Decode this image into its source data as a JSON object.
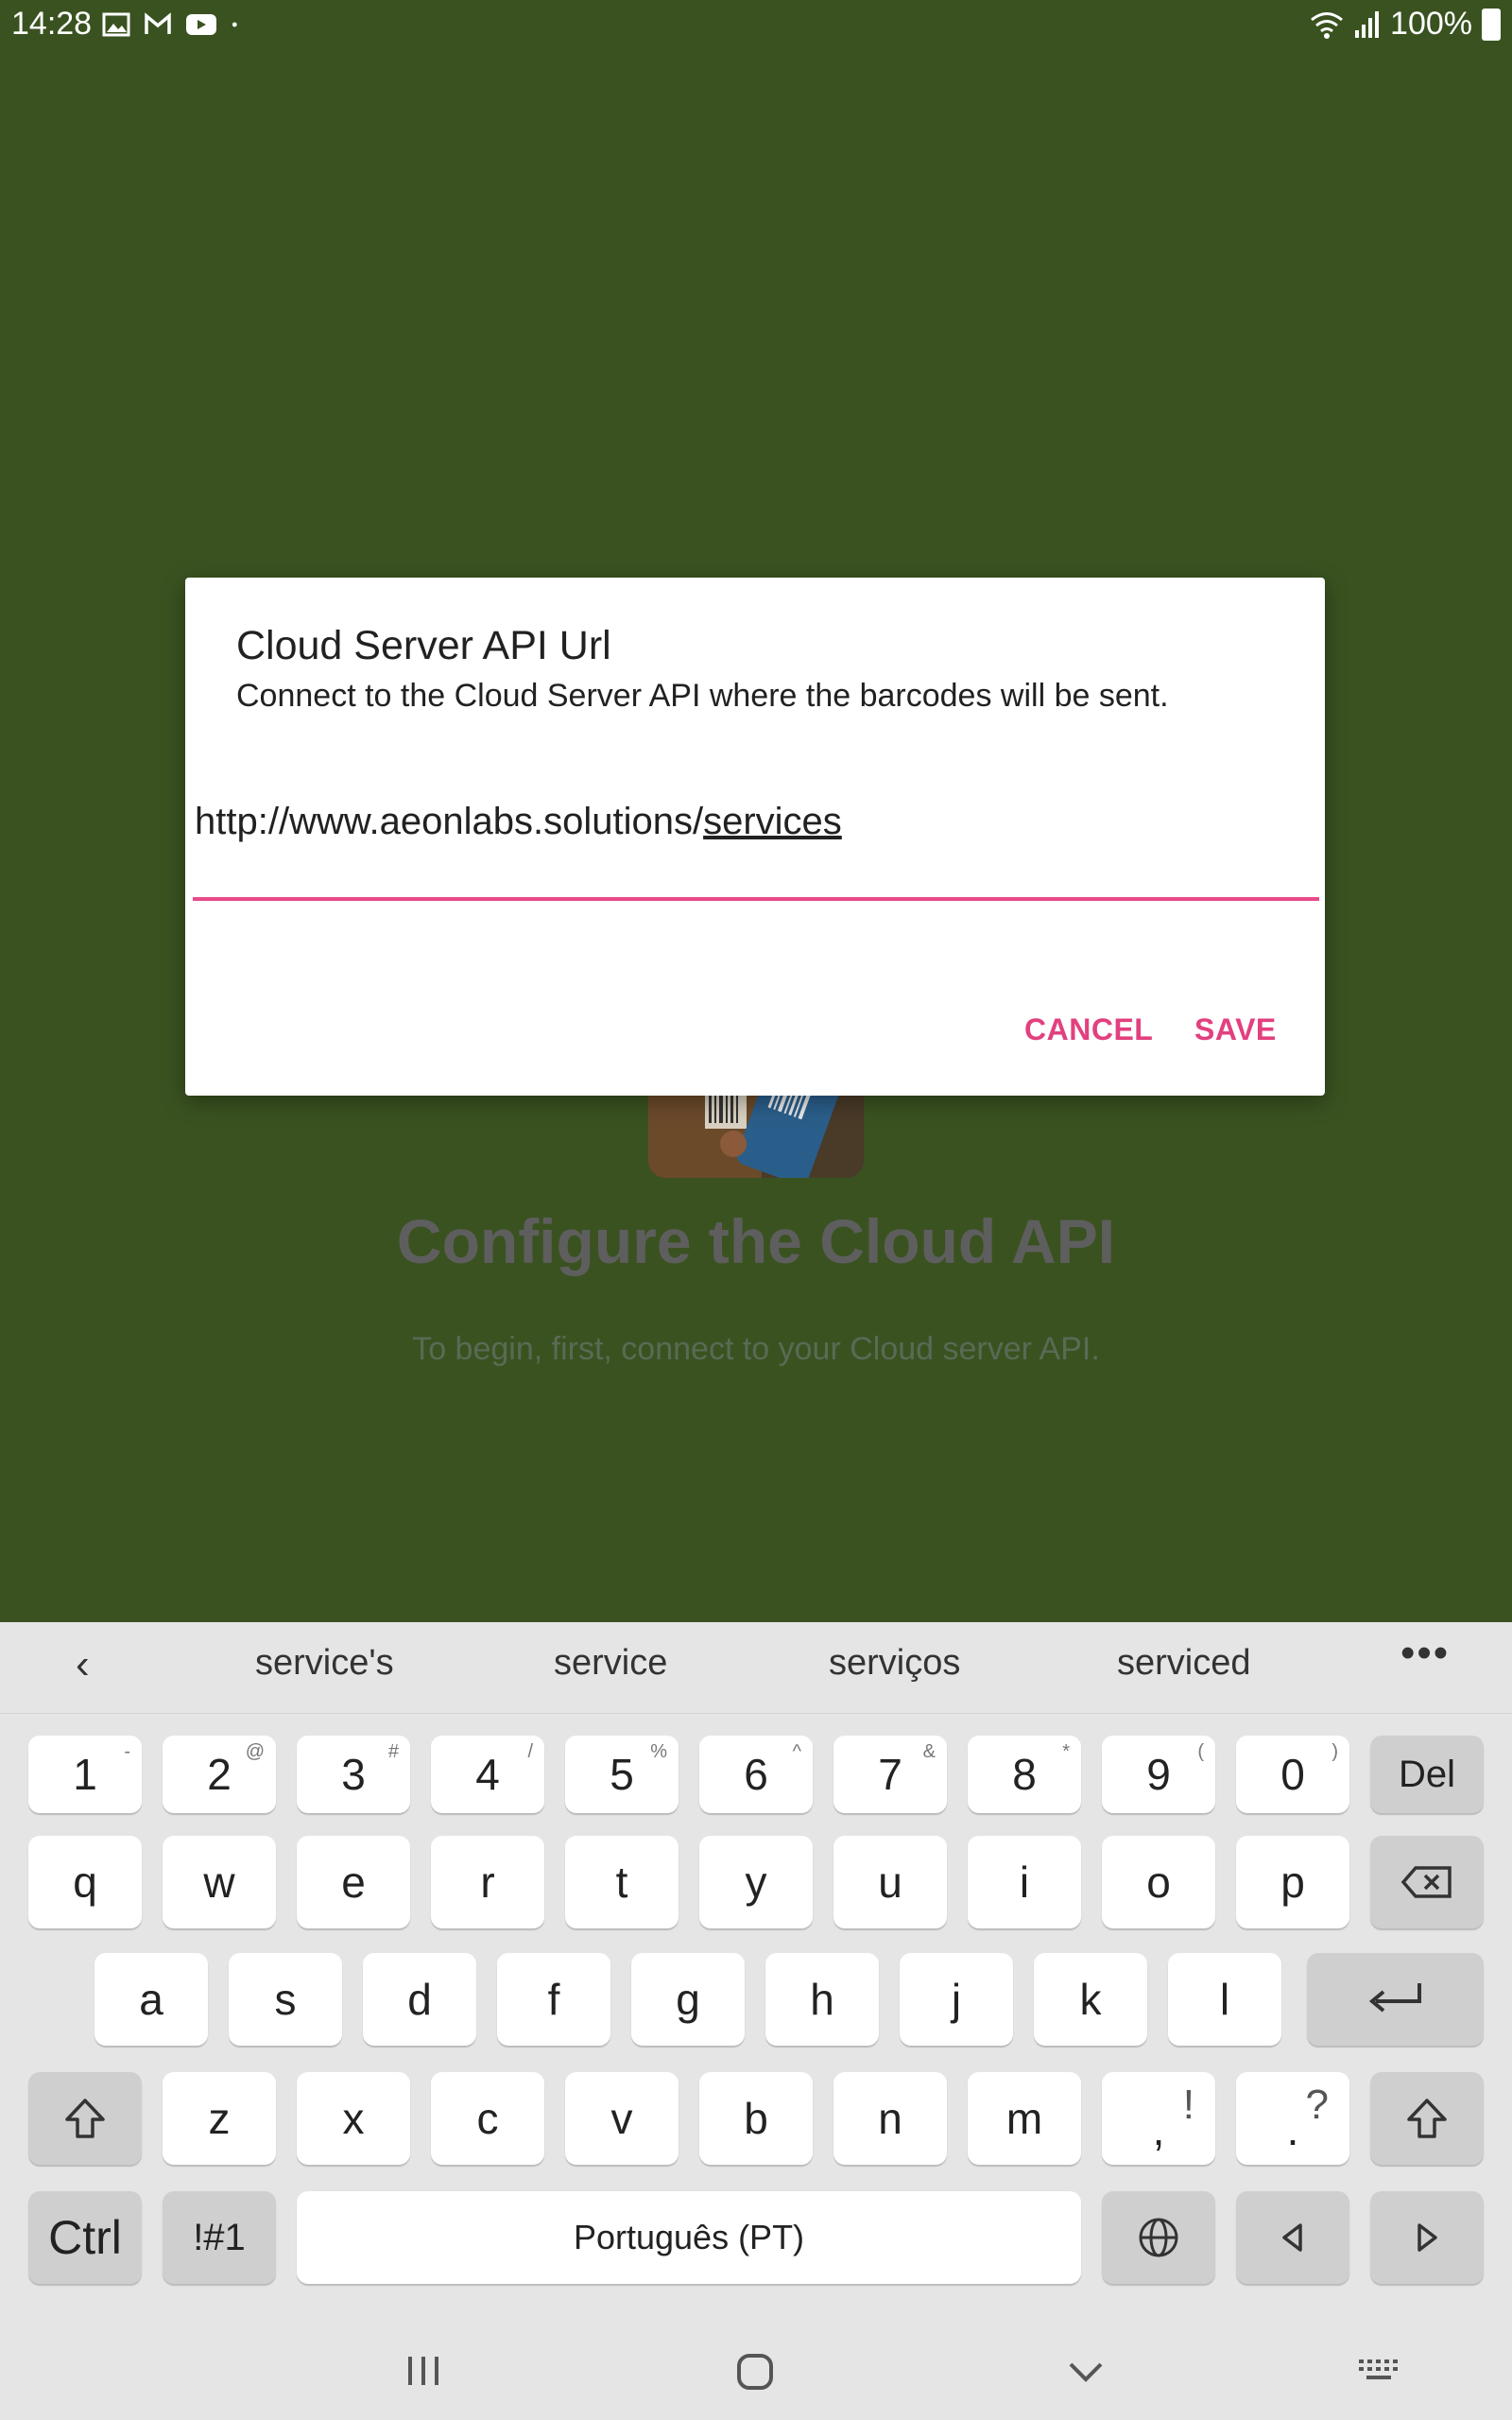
{
  "status_bar": {
    "time": "14:28",
    "battery": "100%",
    "left_icons": [
      "gallery-icon",
      "gmail-icon",
      "youtube-icon",
      "notification-dot-icon"
    ],
    "right_icons": [
      "wifi-icon",
      "signal-icon",
      "battery-icon"
    ]
  },
  "background": {
    "title": "Configure the Cloud API",
    "subtitle": "To begin, first, connect to your Cloud server API."
  },
  "dialog": {
    "title": "Cloud Server API Url",
    "message": "Connect to the Cloud Server API where the barcodes will be sent.",
    "url_prefix": "http://www.aeonlabs.solutions/",
    "url_composing": "services",
    "cancel_label": "CANCEL",
    "save_label": "SAVE"
  },
  "keyboard": {
    "suggestions": [
      "service's",
      "service",
      "serviços",
      "serviced"
    ],
    "number_row": [
      "1",
      "2",
      "3",
      "4",
      "5",
      "6",
      "7",
      "8",
      "9",
      "0"
    ],
    "number_row_secondary": [
      "-",
      "@",
      "#",
      "/",
      "%",
      "^",
      "&",
      "*",
      "(",
      ")"
    ],
    "del_label": "Del",
    "row_q": [
      "q",
      "w",
      "e",
      "r",
      "t",
      "y",
      "u",
      "i",
      "o",
      "p"
    ],
    "row_a": [
      "a",
      "s",
      "d",
      "f",
      "g",
      "h",
      "j",
      "k",
      "l"
    ],
    "row_z": [
      "z",
      "x",
      "c",
      "v",
      "b",
      "n",
      "m"
    ],
    "comma": ",",
    "comma_secondary": "!",
    "period": ".",
    "period_secondary": "?",
    "ctrl_label": "Ctrl",
    "symbols_label": "!#1",
    "space_label": "Português (PT)",
    "colors": {
      "key": "#ffffff",
      "key_dark": "#cfcfcf",
      "bg": "#e5e5e5"
    }
  },
  "colors": {
    "background": "#3a5220",
    "accent": "#e2407f"
  }
}
